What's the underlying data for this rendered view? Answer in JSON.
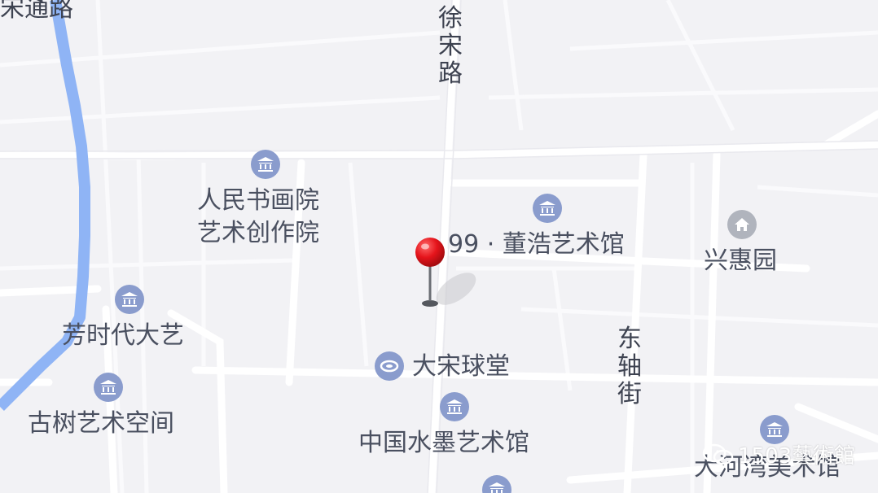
{
  "roads": {
    "xusong_road": "徐宋路",
    "dongzhou_street": "东轴街",
    "songtong_road": "宋通路"
  },
  "pois": {
    "renmin_art": {
      "line1": "人民书画院",
      "line2": "艺术创作院",
      "icon": "museum-icon"
    },
    "dong_hao": {
      "label": "99 · 董浩艺术馆",
      "icon": "museum-icon"
    },
    "xinghui": {
      "label": "兴惠园",
      "icon": "home-icon"
    },
    "fangshidai": {
      "label": "芳时代大艺",
      "icon": "museum-icon"
    },
    "gushu": {
      "label": "古树艺术空间",
      "icon": "museum-icon"
    },
    "dasong_qiutang": {
      "label": "大宋球堂",
      "icon": "stadium-icon"
    },
    "china_ink": {
      "label": "中国水墨艺术馆",
      "icon": "museum-icon"
    },
    "dahewan": {
      "label": "大河湾美术馆",
      "icon": "museum-icon"
    }
  },
  "marker": {
    "color": "#e5141b",
    "icon": "location-pin-icon"
  },
  "watermark": {
    "text": "1503藝術館",
    "icon": "wechat-icon"
  },
  "colors": {
    "water": "#8fb4f5",
    "road": "#ffffff",
    "background": "#f2f2f5",
    "poi_icon": "#8a9ccd"
  }
}
